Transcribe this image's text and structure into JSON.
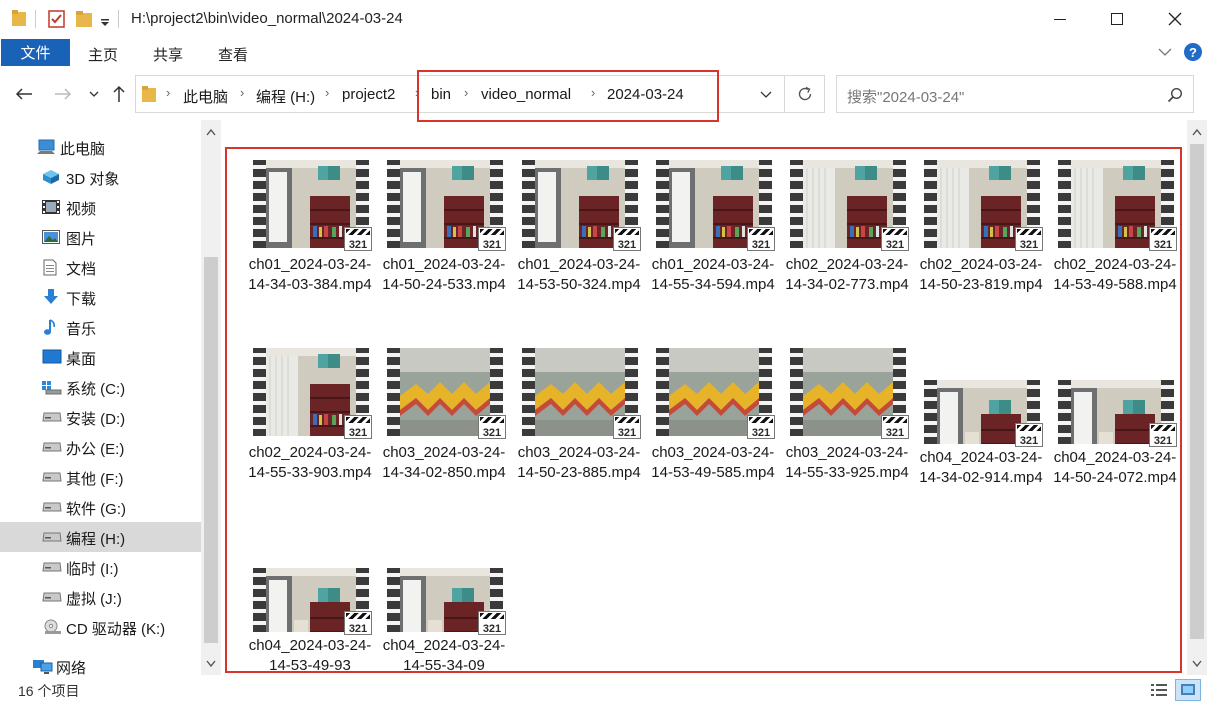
{
  "window": {
    "title": "H:\\project2\\bin\\video_normal\\2024-03-24",
    "minimize_label": "─",
    "maximize_label": "☐",
    "close_label": "✕"
  },
  "ribbon": {
    "file_tab": "文件",
    "tabs": [
      "主页",
      "共享",
      "查看"
    ],
    "help_label": "?"
  },
  "address_bar": {
    "crumbs": [
      "此电脑",
      "编程 (H:)",
      "project2",
      "bin",
      "video_normal",
      "2024-03-24"
    ]
  },
  "search": {
    "placeholder": "搜索\"2024-03-24\""
  },
  "sidebar": {
    "items": [
      {
        "label": "此电脑",
        "icon": "computer-icon"
      },
      {
        "label": "3D 对象",
        "icon": "3d-objects-icon"
      },
      {
        "label": "视频",
        "icon": "video-folder-icon"
      },
      {
        "label": "图片",
        "icon": "pictures-folder-icon"
      },
      {
        "label": "文档",
        "icon": "documents-folder-icon"
      },
      {
        "label": "下载",
        "icon": "download-icon"
      },
      {
        "label": "音乐",
        "icon": "music-icon"
      },
      {
        "label": "桌面",
        "icon": "desktop-icon"
      },
      {
        "label": "系统 (C:)",
        "icon": "windows-drive-icon"
      },
      {
        "label": "安装 (D:)",
        "icon": "drive-icon"
      },
      {
        "label": "办公 (E:)",
        "icon": "drive-icon"
      },
      {
        "label": "其他 (F:)",
        "icon": "drive-icon"
      },
      {
        "label": "软件 (G:)",
        "icon": "drive-icon"
      },
      {
        "label": "编程 (H:)",
        "icon": "drive-icon",
        "selected": true
      },
      {
        "label": "临时 (I:)",
        "icon": "drive-icon"
      },
      {
        "label": "虚拟 (J:)",
        "icon": "drive-icon"
      },
      {
        "label": "CD 驱动器 (K:)",
        "icon": "cd-drive-icon"
      },
      {
        "label": "网络",
        "icon": "network-icon"
      }
    ]
  },
  "files": [
    {
      "name": "ch01_2024-03-24-14-34-03-384.mp4",
      "scene": "room"
    },
    {
      "name": "ch01_2024-03-24-14-50-24-533.mp4",
      "scene": "room"
    },
    {
      "name": "ch01_2024-03-24-14-53-50-324.mp4",
      "scene": "room"
    },
    {
      "name": "ch01_2024-03-24-14-55-34-594.mp4",
      "scene": "room"
    },
    {
      "name": "ch02_2024-03-24-14-34-02-773.mp4",
      "scene": "wardrobe"
    },
    {
      "name": "ch02_2024-03-24-14-50-23-819.mp4",
      "scene": "wardrobe"
    },
    {
      "name": "ch02_2024-03-24-14-53-49-588.mp4",
      "scene": "wardrobe"
    },
    {
      "name": "ch02_2024-03-24-14-55-33-903.mp4",
      "scene": "wardrobe"
    },
    {
      "name": "ch03_2024-03-24-14-34-02-850.mp4",
      "scene": "street"
    },
    {
      "name": "ch03_2024-03-24-14-50-23-885.mp4",
      "scene": "street"
    },
    {
      "name": "ch03_2024-03-24-14-53-49-585.mp4",
      "scene": "street"
    },
    {
      "name": "ch03_2024-03-24-14-55-33-925.mp4",
      "scene": "street"
    },
    {
      "name": "ch04_2024-03-24-14-34-02-914.mp4",
      "scene": "wide"
    },
    {
      "name": "ch04_2024-03-24-14-50-24-072.mp4",
      "scene": "wide"
    },
    {
      "name": "ch04_2024-03-24-14-53-49-93",
      "scene": "wide"
    },
    {
      "name": "ch04_2024-03-24-14-55-34-09",
      "scene": "wide"
    }
  ],
  "thumbnail_badge": "321",
  "status": {
    "item_count": "16 个项目"
  },
  "colors": {
    "accent": "#1a62b8",
    "highlight_box": "#d9342b",
    "selected_nav": "#d9d9d9"
  }
}
